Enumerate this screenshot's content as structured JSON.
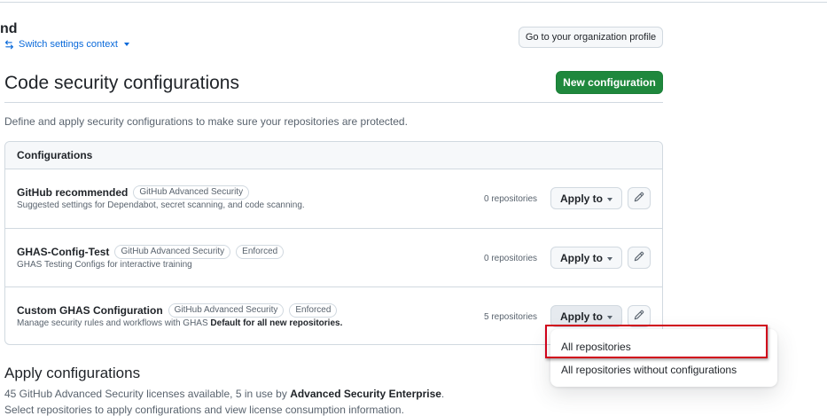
{
  "header": {
    "org_name": "nd",
    "switch_context": "Switch settings context",
    "profile_button": "Go to your organization profile"
  },
  "page": {
    "title": "Code security configurations",
    "new_button": "New configuration",
    "description": "Define and apply security configurations to make sure your repositories are protected."
  },
  "configurations": {
    "heading": "Configurations",
    "apply_label": "Apply to",
    "rows": [
      {
        "name": "GitHub recommended",
        "badges": [
          "GitHub Advanced Security"
        ],
        "description": "Suggested settings for Dependabot, secret scanning, and code scanning.",
        "default_note": "",
        "count": "0 repositories"
      },
      {
        "name": "GHAS-Config-Test",
        "badges": [
          "GitHub Advanced Security",
          "Enforced"
        ],
        "description": "GHAS Testing Configs for interactive training",
        "default_note": "",
        "count": "0 repositories"
      },
      {
        "name": "Custom GHAS Configuration",
        "badges": [
          "GitHub Advanced Security",
          "Enforced"
        ],
        "description": "Manage security rules and workflows with GHAS",
        "default_note": "Default for all new repositories.",
        "count": "5 repositories"
      }
    ]
  },
  "apply_section": {
    "title": "Apply configurations",
    "licenses_prefix": "45 GitHub Advanced Security licenses available, 5 in use by ",
    "licenses_org": "Advanced Security Enterprise",
    "licenses_suffix": ".",
    "select_text": "Select repositories to apply configurations and view license consumption information."
  },
  "dropdown": {
    "items": [
      "All repositories",
      "All repositories without configurations"
    ]
  },
  "colors": {
    "primary_button": "#1f883d",
    "link": "#0969da",
    "highlight_box": "#d0021b"
  },
  "icons": {
    "switch": "arrow-switch-icon",
    "edit": "pencil-icon",
    "caret": "triangle-down-icon"
  }
}
